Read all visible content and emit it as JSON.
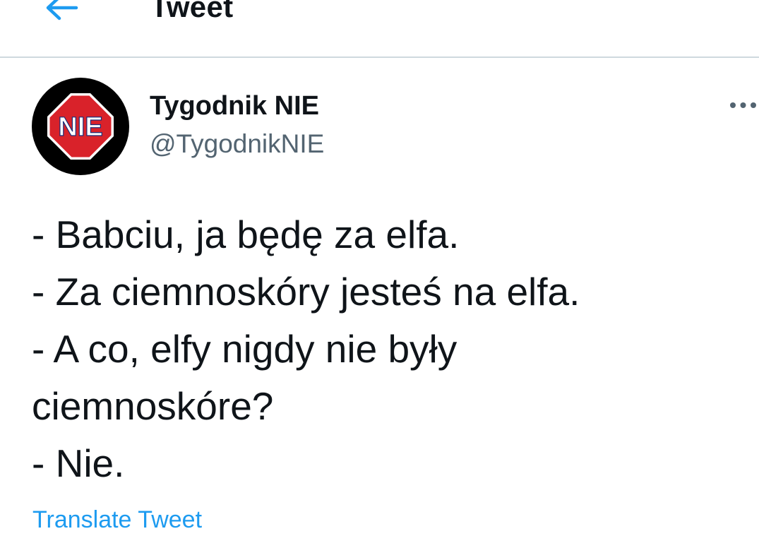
{
  "header": {
    "title": "Tweet",
    "back_icon": "arrow-left-icon"
  },
  "author": {
    "display_name": "Tygodnik NIE",
    "handle": "@TygodnikNIE",
    "avatar_text": "NIE",
    "more_icon": "more-horizontal-icon"
  },
  "tweet": {
    "lines": [
      "- Babciu, ja będę za elfa.",
      "- Za ciemnoskóry jesteś na elfa.",
      "- A co, elfy nigdy nie były",
      "ciemnoskóre?",
      "- Nie."
    ]
  },
  "translate": {
    "label": "Translate Tweet"
  },
  "colors": {
    "accent": "#1d9bf0",
    "text_primary": "#0f1419",
    "text_secondary": "#536471",
    "divider": "#cfd9de",
    "avatar_octagon": "#d9222a"
  }
}
